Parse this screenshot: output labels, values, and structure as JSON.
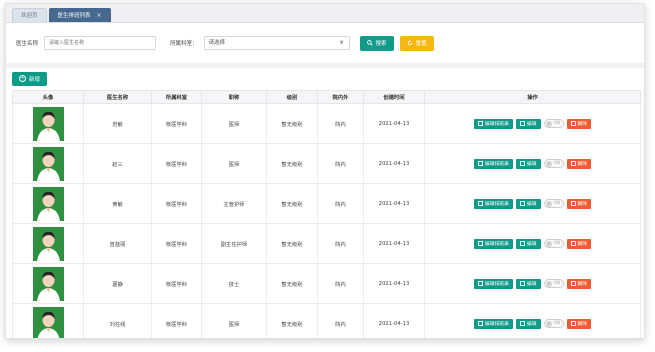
{
  "tabs": [
    {
      "label": "欢迎页",
      "active": false
    },
    {
      "label": "医生排班列表",
      "active": true,
      "close": "×"
    }
  ],
  "filter": {
    "name_label": "医生名称",
    "name_placeholder": "请输入医生名称",
    "dept_label": "所属科室：",
    "dept_selected": "请选择",
    "search_label": "搜索",
    "reset_label": "重置"
  },
  "toolbar": {
    "add_label": "新增"
  },
  "table": {
    "headers": [
      "头像",
      "医生名称",
      "所属科室",
      "职称",
      "级别",
      "院内外",
      "创建时间",
      "操作"
    ],
    "rows": [
      {
        "name": "范敏",
        "dept": "核医学科",
        "title": "医师",
        "level": "暂无级别",
        "inout": "院内",
        "created": "2021-04-13"
      },
      {
        "name": "赵三",
        "dept": "核医学科",
        "title": "医师",
        "level": "暂无级别",
        "inout": "院内",
        "created": "2021-04-13"
      },
      {
        "name": "黄敏",
        "dept": "核医学科",
        "title": "主管护师",
        "level": "暂无级别",
        "inout": "院内",
        "created": "2021-04-13"
      },
      {
        "name": "曾蓝丽",
        "dept": "核医学科",
        "title": "副主任护师",
        "level": "暂无级别",
        "inout": "院内",
        "created": "2021-04-13"
      },
      {
        "name": "葛静",
        "dept": "核医学科",
        "title": "技士",
        "level": "暂无级别",
        "inout": "院内",
        "created": "2021-04-13"
      },
      {
        "name": "刘在线",
        "dept": "核医学科",
        "title": "医师",
        "level": "暂无级别",
        "inout": "院内",
        "created": "2021-04-13"
      }
    ],
    "actions": {
      "schedule": "编辑排班表",
      "edit": "编辑",
      "toggle": "ON",
      "delete": "删除"
    }
  },
  "colors": {
    "accent": "#109a88",
    "warning": "#f5b712",
    "danger": "#ef5b30",
    "tab_active": "#47698f"
  }
}
